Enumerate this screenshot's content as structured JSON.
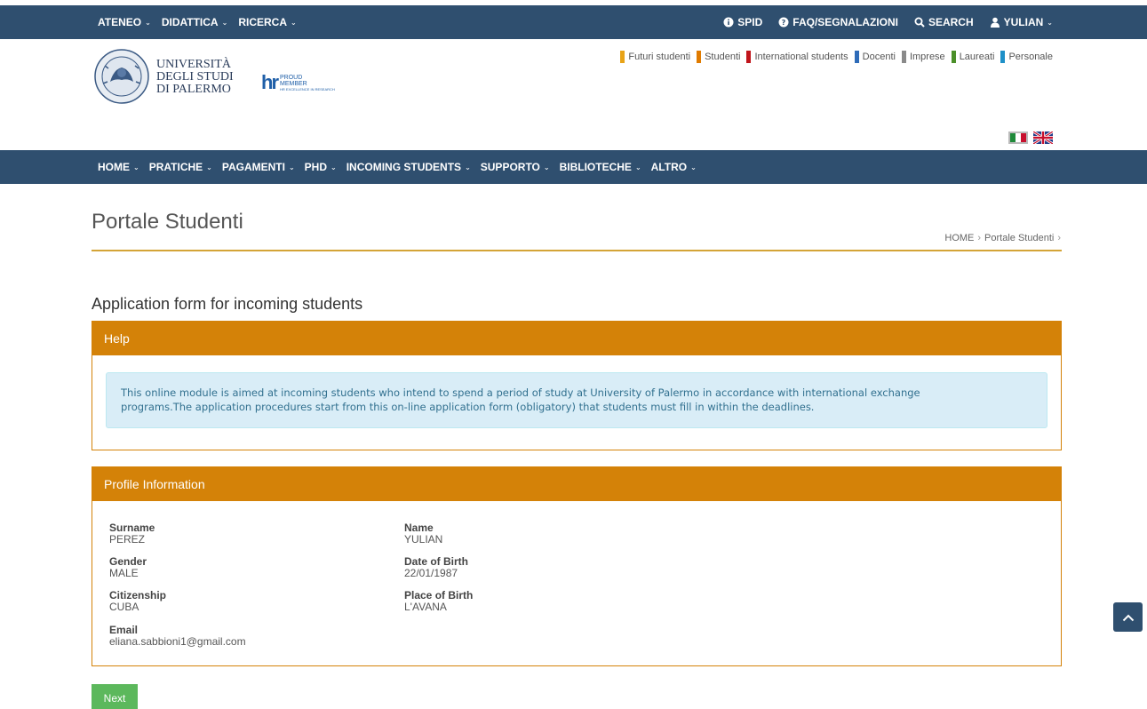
{
  "topbar": {
    "left": [
      {
        "label": "ATENEO"
      },
      {
        "label": "DIDATTICA"
      },
      {
        "label": "RICERCA"
      }
    ],
    "spid": "SPID",
    "faq": "FAQ/SEGNALAZIONI",
    "search": "SEARCH",
    "user": "YULIAN"
  },
  "header": {
    "university_line1": "UNIVERSITÀ",
    "university_line2": "DEGLI STUDI",
    "university_line3": "DI PALERMO",
    "hr_mark": "hr",
    "hr_line1": "PROUD",
    "hr_line2": "MEMBER",
    "hr_sub": "HR EXCELLENCE IN RESEARCH",
    "audience": [
      {
        "label": "Futuri studenti",
        "color": "#e8a317"
      },
      {
        "label": "Studenti",
        "color": "#e07b00"
      },
      {
        "label": "International students",
        "color": "#c0141b"
      },
      {
        "label": "Docenti",
        "color": "#2e6bb8"
      },
      {
        "label": "Imprese",
        "color": "#8a8a8a"
      },
      {
        "label": "Laureati",
        "color": "#4b8f29"
      },
      {
        "label": "Personale",
        "color": "#1e90c8"
      }
    ]
  },
  "nav": [
    {
      "label": "HOME"
    },
    {
      "label": "PRATICHE"
    },
    {
      "label": "PAGAMENTI"
    },
    {
      "label": "PHD"
    },
    {
      "label": "INCOMING STUDENTS"
    },
    {
      "label": "SUPPORTO"
    },
    {
      "label": "BIBLIOTECHE"
    },
    {
      "label": "ALTRO"
    }
  ],
  "page": {
    "title": "Portale Studenti",
    "breadcrumb_home": "HOME",
    "breadcrumb_current": "Portale Studenti",
    "form_title": "Application form for incoming students"
  },
  "help": {
    "heading": "Help",
    "text_line1": "This online module is aimed at incoming students who intend to spend a period of study at University of Palermo in accordance with international exchange",
    "text_line2": "programs.The application procedures start from this on-line application form (obligatory) that students must fill in within the deadlines."
  },
  "profile": {
    "heading": "Profile Information",
    "surname_label": "Surname",
    "surname": "PEREZ",
    "name_label": "Name",
    "name": "YULIAN",
    "gender_label": "Gender",
    "gender": "MALE",
    "dob_label": "Date of Birth",
    "dob": "22/01/1987",
    "citizenship_label": "Citizenship",
    "citizenship": "CUBA",
    "pob_label": "Place of Birth",
    "pob": "L'AVANA",
    "email_label": "Email",
    "email": "eliana.sabbioni1@gmail.com"
  },
  "actions": {
    "next": "Next"
  },
  "colors": {
    "navy": "#2f4f6f",
    "orange": "#d48208",
    "gold_rule": "#d4a437",
    "alert_bg": "#d9edf7",
    "success": "#5cb85c"
  }
}
